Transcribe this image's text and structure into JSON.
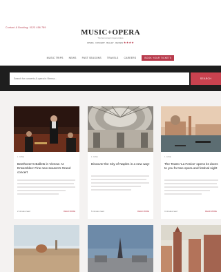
{
  "header": {
    "promo_text": "Contact & Booking: 0123 456 789",
    "logo": "MUSIC+OPERA",
    "tagline": "The best concert & opera tickets",
    "subline": "OPERA · CONCERT · BALLET · REVIEW",
    "stars": "★★★★"
  },
  "nav": {
    "items": [
      "MUSIC TRIPS",
      "NEWS",
      "PAST SEASONS",
      "TRAVELS",
      "CAREERS"
    ],
    "book_label": "BOOK YOUR TICKETS"
  },
  "search": {
    "placeholder": "Search for concerts & opera in Vienna...",
    "button_label": "SEARCH"
  },
  "cards": [
    {
      "date": "1 JUNE",
      "title": "Beethoven's Ballets in Vienna: At Ensembles: Fine new season's Grand concert",
      "footer_left": "2 minutes read",
      "footer_right": "READ MORE"
    },
    {
      "date": "1 JUNE",
      "title": "Discover the City of Naples in a new way!",
      "footer_left": "6 minutes read",
      "footer_right": "READ MORE"
    },
    {
      "date": "1 JUNE",
      "title": "The Teatro 'La Fenice' opens its doors to you for two opera and festival night",
      "footer_left": "4 minutes read",
      "footer_right": "READ MORE"
    }
  ]
}
